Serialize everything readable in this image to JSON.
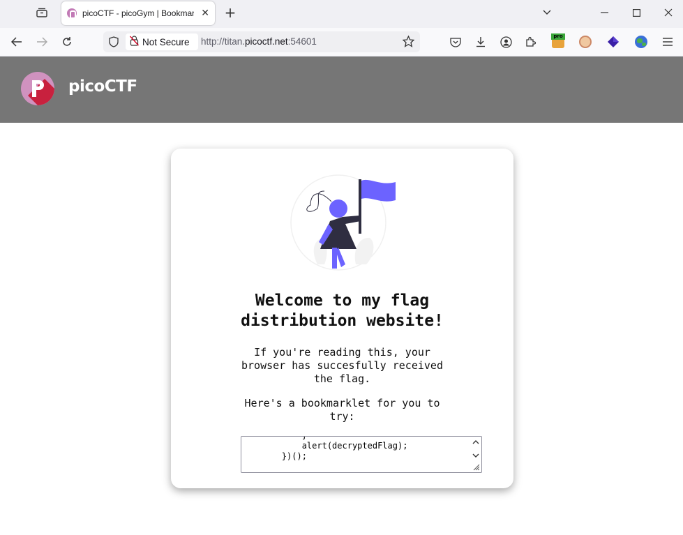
{
  "browser": {
    "tab_title": "picoCTF - picoGym | Bookmarklet",
    "security_label": "Not Secure",
    "url_prefix": "http://titan.",
    "url_domain": "picoctf.net",
    "url_suffix": ":54601"
  },
  "header": {
    "brand": "picoCTF"
  },
  "card": {
    "heading": "Welcome to my flag distribution website!",
    "intro": "If you're reading this, your browser has succesfully received the flag.",
    "prompt": "Here's a bookmarklet for you to try:",
    "code": "            }\n            alert(decryptedFlag);\n        })();"
  },
  "colors": {
    "header_bg": "#767676",
    "accent": "#6c63ff",
    "logo_pink": "#d092bf",
    "logo_red": "#c8213e"
  }
}
